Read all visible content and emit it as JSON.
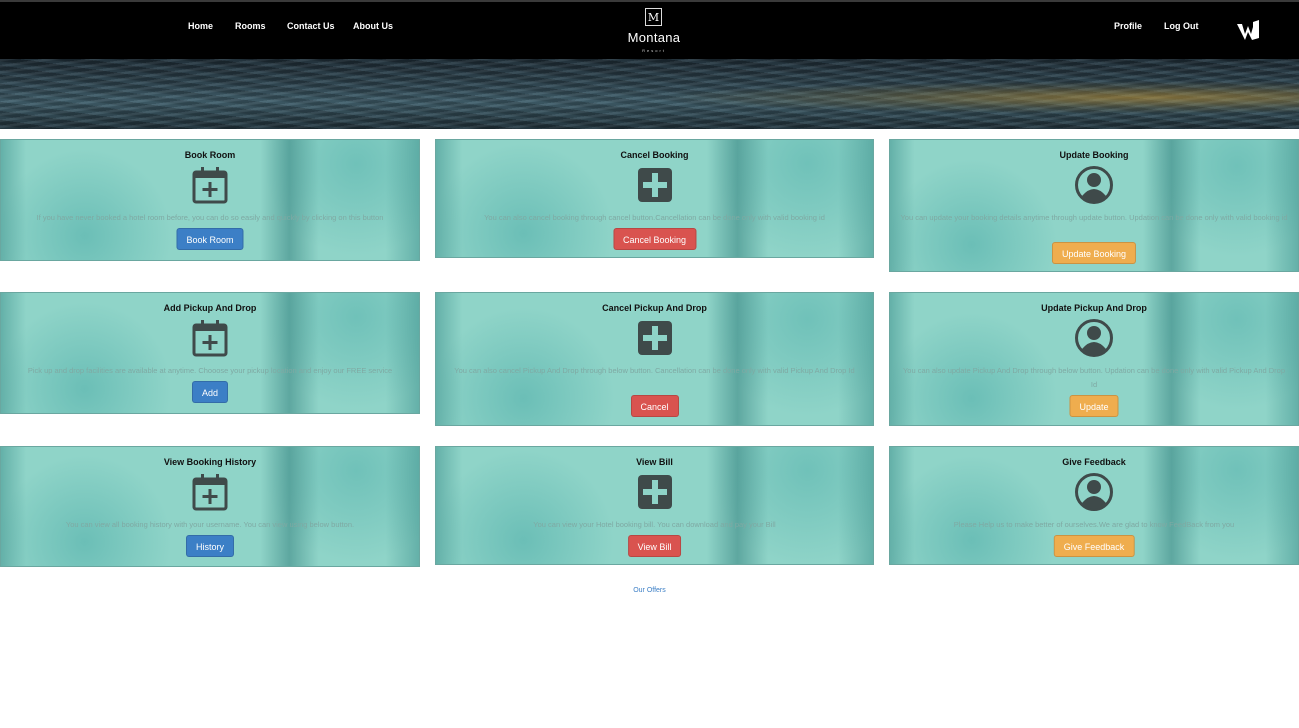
{
  "nav": {
    "left": [
      "Home",
      "Rooms",
      "Contact Us",
      "About Us"
    ],
    "right": [
      "Profile",
      "Log Out"
    ]
  },
  "brand": {
    "mark": "M",
    "name": "Montana",
    "tagline": "Resort"
  },
  "colors": {
    "primary": "#3c7fc6",
    "danger": "#d9534f",
    "warning": "#efad4e",
    "card": "#8fd4c8"
  },
  "cards": [
    {
      "title": "Book Room",
      "icon": "calendar-plus-icon",
      "desc": "If you have never booked a hotel room before, you can do so easily and quickly by clicking on this button",
      "button": "Book Room"
    },
    {
      "title": "Cancel Booking",
      "icon": "plus-square-icon",
      "desc": "You can also cancel booking through cancel button.Cancellation can be done only with valid booking id",
      "button": "Cancel Booking"
    },
    {
      "title": "Update Booking",
      "icon": "user-circle-icon",
      "desc": "You can update your booking details anytime through update button. Updation can be done only with valid booking id",
      "button": "Update Booking"
    },
    {
      "title": "Add Pickup And Drop",
      "icon": "calendar-plus-icon",
      "desc": "Pick up and drop facilities are available at anytime. Chooose your pickup location and enjoy our FREE service",
      "button": "Add"
    },
    {
      "title": "Cancel Pickup And Drop",
      "icon": "plus-square-icon",
      "desc": "You can also cancel Pickup And Drop through below button. Cancellation can be done only with valid Pickup And Drop Id",
      "button": "Cancel"
    },
    {
      "title": "Update Pickup And Drop",
      "icon": "user-circle-icon",
      "desc": "You can also update Pickup And Drop through below button. Updation can be done only with valid Pickup And Drop Id",
      "button": "Update"
    },
    {
      "title": "View Booking History",
      "icon": "calendar-plus-icon",
      "desc": "You can view all booking history with your username. You can view using below button.",
      "button": "History"
    },
    {
      "title": "View Bill",
      "icon": "plus-square-icon",
      "desc": "You can view your Hotel booking bill. You can download and pay your Bill",
      "button": "View Bill"
    },
    {
      "title": "Give Feedback",
      "icon": "user-circle-icon",
      "desc": "Please Help us to make better of ourselves.We are glad to know FeedBack from you",
      "button": "Give Feedback"
    }
  ],
  "footer": {
    "link": "Our Offers"
  }
}
